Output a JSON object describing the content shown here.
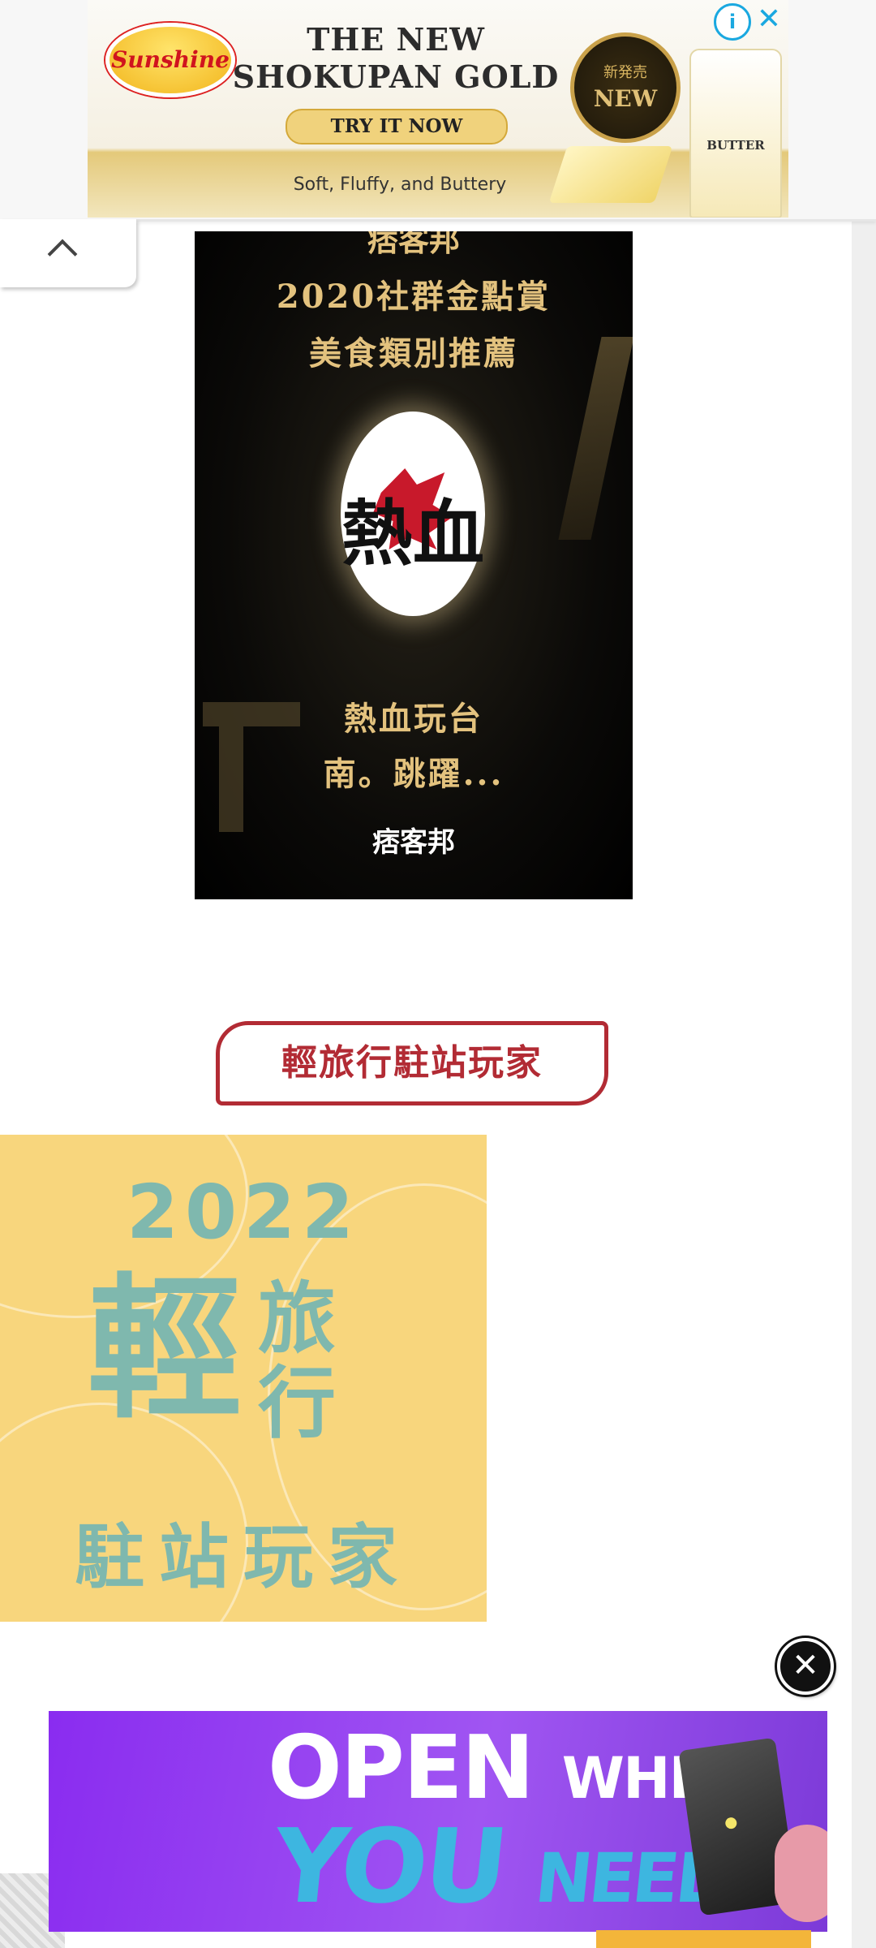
{
  "top_ad": {
    "logo_text": "Sunshine",
    "headline_line1": "THE NEW",
    "headline_line2": "SHOKUPAN GOLD",
    "cta": "TRY IT NOW",
    "tagline": "Soft, Fluffy, and Buttery",
    "badge_small": "新発売",
    "badge_big": "NEW",
    "bag_label": "BUTTER",
    "info_icon": "i",
    "close_icon": "✕"
  },
  "collapse_tab": {
    "icon": "chevron-up-icon"
  },
  "award_image": {
    "top_partial": "痞客邦",
    "line1": "2020社群金點賞",
    "line2": "美食類別推薦",
    "calligraphy": "熱血",
    "line3": "熱血玩台",
    "line4": "南。跳躍...",
    "logo": "痞客邦"
  },
  "section_title": "輕旅行駐站玩家",
  "travel_banner": {
    "year": "2022",
    "big_char": "輕",
    "stack_char1": "旅",
    "stack_char2": "行",
    "subtitle": "駐站玩家"
  },
  "bottom_ad": {
    "close_icon": "✕",
    "line1_a": "OPEN",
    "line1_b": "WHEN",
    "line2_a": "YOU",
    "line2_b": "NEED US"
  },
  "colors": {
    "accent_red": "#b22b34",
    "travel_yellow": "#f8d67d",
    "travel_teal": "#7fb8ae",
    "ad_purple": "#8a2cf0"
  }
}
